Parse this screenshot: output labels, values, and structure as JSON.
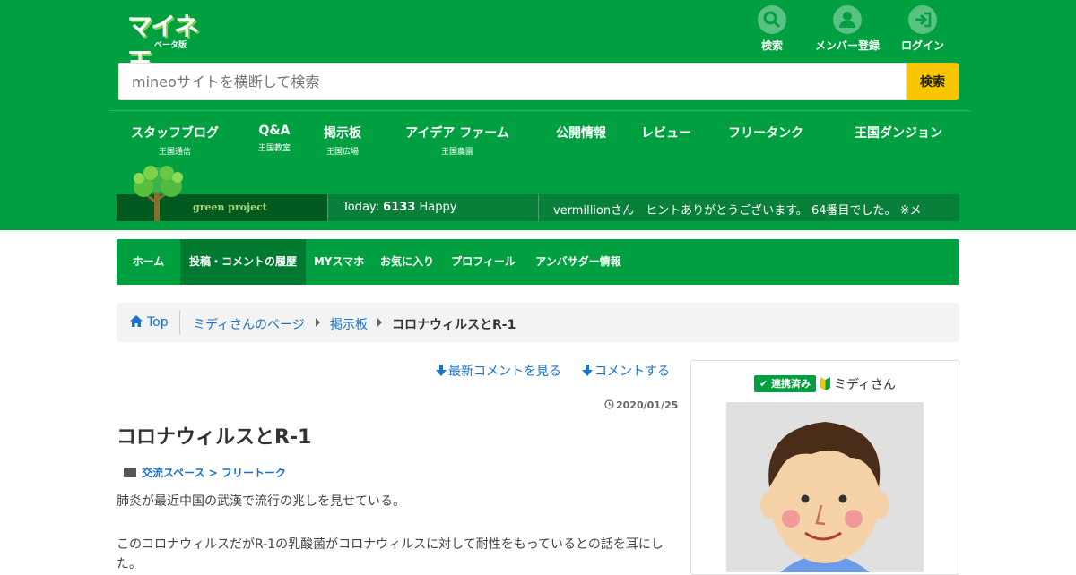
{
  "header": {
    "logo": {
      "mark": "マイネ王",
      "beta": "ベータ版"
    },
    "buttons": [
      {
        "label": "検索",
        "icon": "search-icon"
      },
      {
        "label": "メンバー登録",
        "icon": "user-icon"
      },
      {
        "label": "ログイン",
        "icon": "login-icon"
      }
    ],
    "search": {
      "placeholder": "mineoサイトを横断して検索",
      "button_label": "検索"
    },
    "nav": [
      {
        "title": "スタッフブログ",
        "sub": "王国通信"
      },
      {
        "title": "Q&A",
        "sub": "王国教室"
      },
      {
        "title": "掲示板",
        "sub": "王国広場"
      },
      {
        "title": "アイデア ファーム",
        "sub": "王国農園"
      },
      {
        "title": "公開情報",
        "sub": ""
      },
      {
        "title": "レビュー",
        "sub": ""
      },
      {
        "title": "フリータンク",
        "sub": ""
      },
      {
        "title": "王国ダンジョン",
        "sub": ""
      }
    ],
    "green_bar": {
      "project_label": "green project",
      "today_prefix": "Today:",
      "today_count": "6133",
      "today_suffix": "Happy",
      "ticker": "vermillionさん　ヒントありがとうございます。 64番目でした。 ※メ"
    }
  },
  "subnav": {
    "items": [
      "ホーム",
      "投稿・コメントの履歴",
      "MYスマホ",
      "お気に入り",
      "プロフィール",
      "アンバサダー情報"
    ],
    "active_index": 1
  },
  "breadcrumb": {
    "home": "Top",
    "items": [
      "ミディさんのページ",
      "掲示板"
    ],
    "current": "コロナウィルスとR-1"
  },
  "post": {
    "links": {
      "latest_comment": "最新コメントを見る",
      "comment": "コメントする"
    },
    "date": "2020/01/25",
    "title": "コロナウィルスとR-1",
    "category": "交流スペース > フリートーク",
    "body": [
      "肺炎が最近中国の武漢で流行の兆しを見せている。",
      "このコロナウィルスだがR-1の乳酸菌がコロナウィルスに対して耐性をもっているとの話を耳にし",
      "た。"
    ]
  },
  "profile": {
    "badge": "連携済み",
    "name": "ミディさん",
    "avatar_icon": "user-avatar-illustration"
  },
  "colors": {
    "brand_green": "#00a040",
    "dark_green": "#007a30",
    "search_yellow": "#f7c600",
    "link_blue": "#1a73c7"
  }
}
